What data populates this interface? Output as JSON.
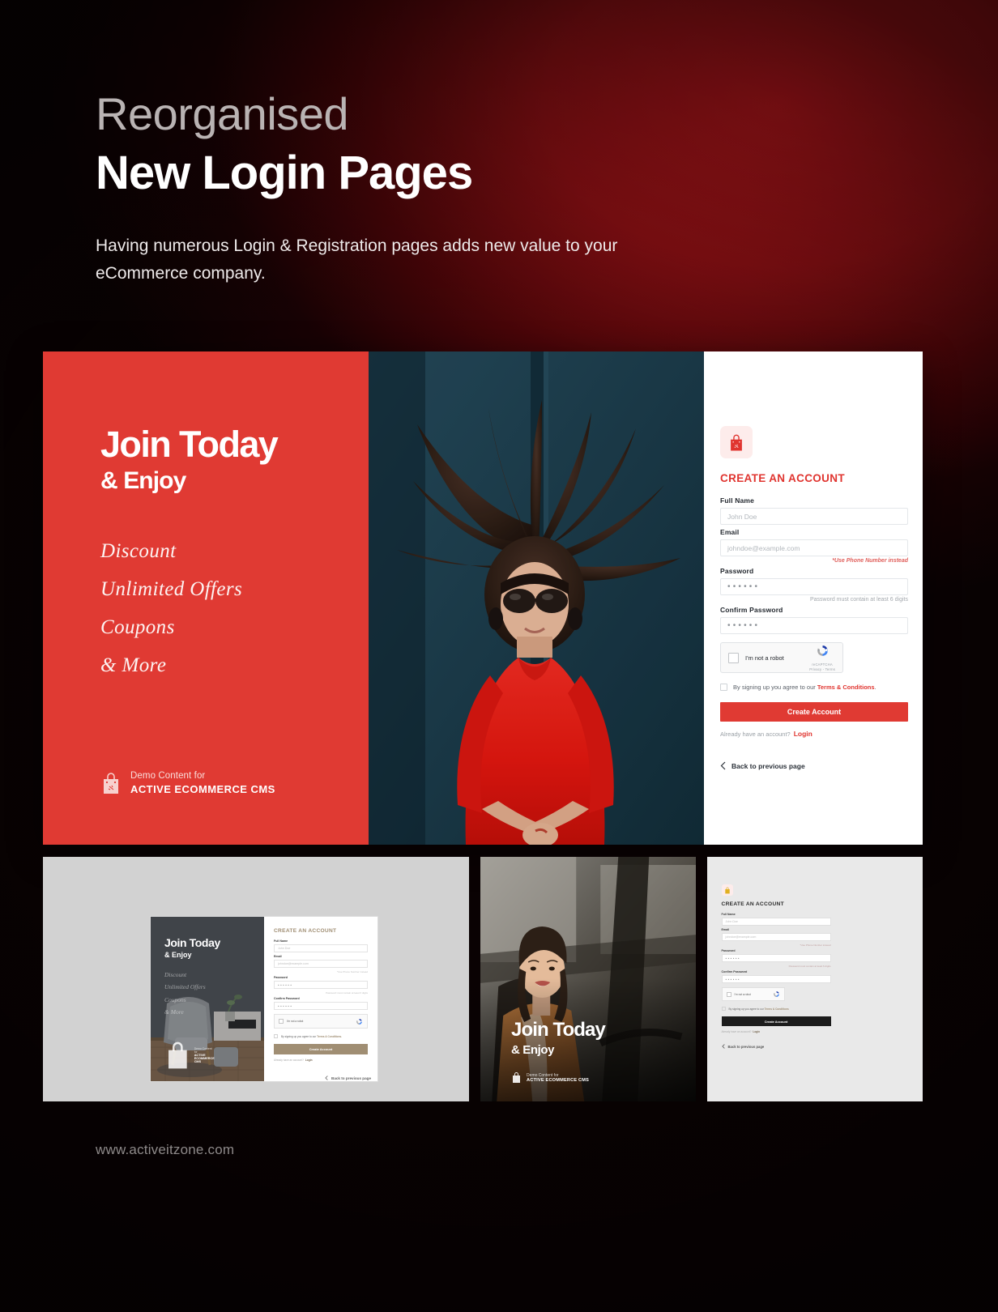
{
  "hero": {
    "kicker": "Reorganised",
    "title": "New Login Pages",
    "subtitle": "Having numerous Login & Registration pages adds new value to your eCommerce company."
  },
  "promo": {
    "heading_line1": "Join Today",
    "heading_line2": "& Enjoy",
    "benefits": [
      "Discount",
      "Unlimited Offers",
      "Coupons",
      "& More"
    ],
    "footer_small": "Demo Content for",
    "footer_brand": "ACTIVE ECOMMERCE CMS"
  },
  "form": {
    "title": "CREATE AN ACCOUNT",
    "fields": [
      {
        "label": "Full Name",
        "placeholder": "John Doe",
        "type": "text",
        "hint": ""
      },
      {
        "label": "Email",
        "placeholder": "johndoe@example.com",
        "type": "text",
        "hint": "*Use Phone Number instead"
      },
      {
        "label": "Password",
        "placeholder": "••••••",
        "type": "password",
        "hint": "Password must contain at least 6 digits"
      },
      {
        "label": "Confirm Password",
        "placeholder": "••••••",
        "type": "password",
        "hint": ""
      }
    ],
    "captcha": {
      "label": "I'm not a robot",
      "brand": "reCAPTCHA",
      "legal": "Privacy - Terms"
    },
    "terms_text": "By signing up you agree to our",
    "terms_link": "Terms & Conditions",
    "terms_period": ".",
    "submit_label": "Create Account",
    "alt_text": "Already have an account?",
    "alt_link": "Login",
    "back_label": "Back to previous page"
  },
  "thumbs": {
    "one": {
      "promo_h1": "Join Today",
      "promo_h2": "& Enjoy",
      "benefits": [
        "Discount",
        "Unlimited Offers",
        "Coupons",
        "& More"
      ],
      "footer_small": "Demo Content for",
      "footer_brand": "ACTIVE ECOMMERCE CMS",
      "form_title": "CREATE AN ACCOUNT",
      "labels": [
        "Full Name",
        "Email",
        "Password",
        "Confirm Password"
      ],
      "ph_name": "John Doe",
      "ph_email": "johndoe@example.com",
      "ph_dots": "••••••",
      "hint_email": "*Use Phone Number instead",
      "hint_pass": "Password must contain at least 6 digits",
      "captcha_label": "I'm not a robot",
      "captcha_brand": "reCAPTCHA",
      "terms_text": "By signing up you agree to our",
      "terms_link": "Terms & Conditions.",
      "submit_label": "Create Account",
      "alt_text": "Already have an account?",
      "alt_link": "Login",
      "back_label": "Back to previous page"
    },
    "two": {
      "h1": "Join Today",
      "h2": "& Enjoy",
      "footer_small": "Demo Content for",
      "footer_brand": "ACTIVE ECOMMERCE CMS"
    },
    "three": {
      "form_title": "CREATE AN ACCOUNT",
      "labels": [
        "Full Name",
        "Email",
        "Password",
        "Confirm Password"
      ],
      "ph_name": "John Doe",
      "ph_email": "johndoe@example.com",
      "ph_dots": "••••••",
      "hint_email": "*Use Phone Number instead",
      "hint_pass": "Password must contain at least 6 digits",
      "captcha_label": "I'm not a robot",
      "captcha_brand": "reCAPTCHA",
      "terms_text": "By signing up you agree to our",
      "terms_link": "Terms & Conditions",
      "submit_label": "Create Account",
      "alt_text": "Already have an account?",
      "alt_link": "Login",
      "back_label": "Back to previous page"
    }
  },
  "footer": {
    "url": "www.activeitzone.com"
  },
  "colors": {
    "brand_red": "#e03a33",
    "bg_red": "#8e1014",
    "form_link": "#e0342f",
    "thumb1_accent": "#a08e73"
  }
}
